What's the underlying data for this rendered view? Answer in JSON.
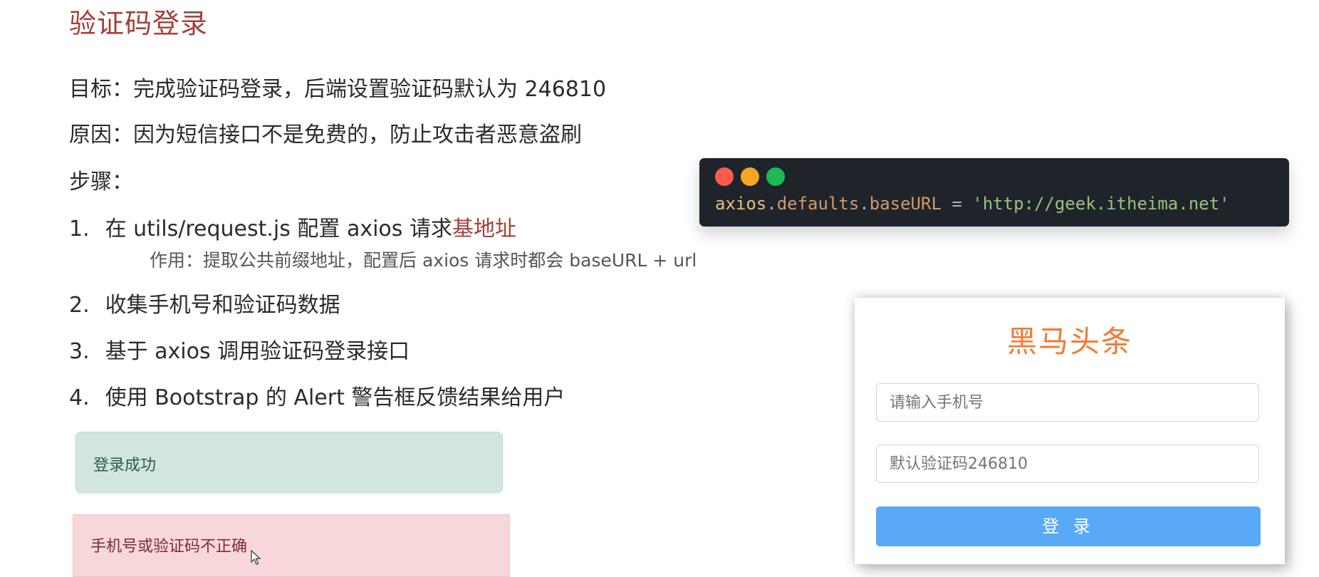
{
  "title": "验证码登录",
  "goal": "目标：完成验证码登录，后端设置验证码默认为 246810",
  "reason": "原因：因为短信接口不是免费的，防止攻击者恶意盗刷",
  "steps_label": "步骤：",
  "steps": [
    {
      "num": "1.",
      "text": "在 utils/request.js 配置 axios 请求",
      "highlight": "基地址"
    },
    {
      "num": "2.",
      "text": "收集手机号和验证码数据"
    },
    {
      "num": "3.",
      "text": "基于 axios 调用验证码登录接口"
    },
    {
      "num": "4.",
      "text": "使用 Bootstrap 的 Alert 警告框反馈结果给用户"
    }
  ],
  "step1_note": "作用：提取公共前缀地址，配置后 axios 请求时都会 baseURL + url",
  "code": {
    "obj": "axios",
    "dot1": ".",
    "prop1": "defaults",
    "dot2": ".",
    "prop2": "baseURL",
    "eq": " = ",
    "str": "'http://geek.itheima.net'"
  },
  "alerts": {
    "success": "登录成功",
    "danger": "手机号或验证码不正确"
  },
  "login_card": {
    "title": "黑马头条",
    "phone_placeholder": "请输入手机号",
    "code_placeholder": "默认验证码246810",
    "button": "登 录"
  },
  "colors": {
    "heading": "#a4403a",
    "card_title": "#f07b36",
    "button": "#5aa9f7",
    "success_bg": "#d1e7dd",
    "danger_bg": "#f8d7da",
    "code_bg": "#1f242b"
  }
}
